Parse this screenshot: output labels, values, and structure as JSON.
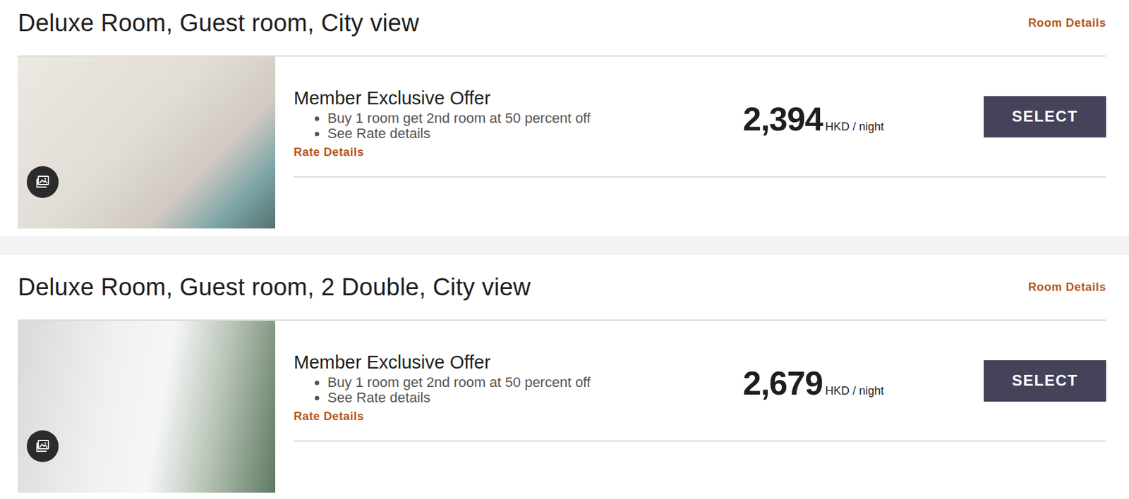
{
  "rooms": [
    {
      "title": "Deluxe Room, Guest room, City view",
      "details_link": "Room Details",
      "offer": {
        "name": "Member Exclusive Offer",
        "bullets": [
          "Buy 1 room get 2nd room at 50 percent off",
          "See Rate details"
        ],
        "rate_link": "Rate Details",
        "price": "2,394",
        "unit": "HKD / night",
        "button": "SELECT"
      }
    },
    {
      "title": "Deluxe Room, Guest room, 2 Double, City view",
      "details_link": "Room Details",
      "offer": {
        "name": "Member Exclusive Offer",
        "bullets": [
          "Buy 1 room get 2nd room at 50 percent off",
          "See Rate details"
        ],
        "rate_link": "Rate Details",
        "price": "2,679",
        "unit": "HKD / night",
        "button": "SELECT"
      }
    }
  ]
}
